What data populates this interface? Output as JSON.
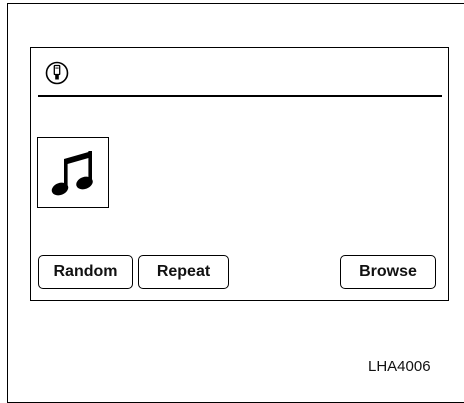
{
  "screen": {
    "source_icon": "usb-icon",
    "album_art_icon": "music-note-icon",
    "buttons": {
      "random_label": "Random",
      "repeat_label": "Repeat",
      "browse_label": "Browse"
    }
  },
  "figure_code": "LHA4006"
}
